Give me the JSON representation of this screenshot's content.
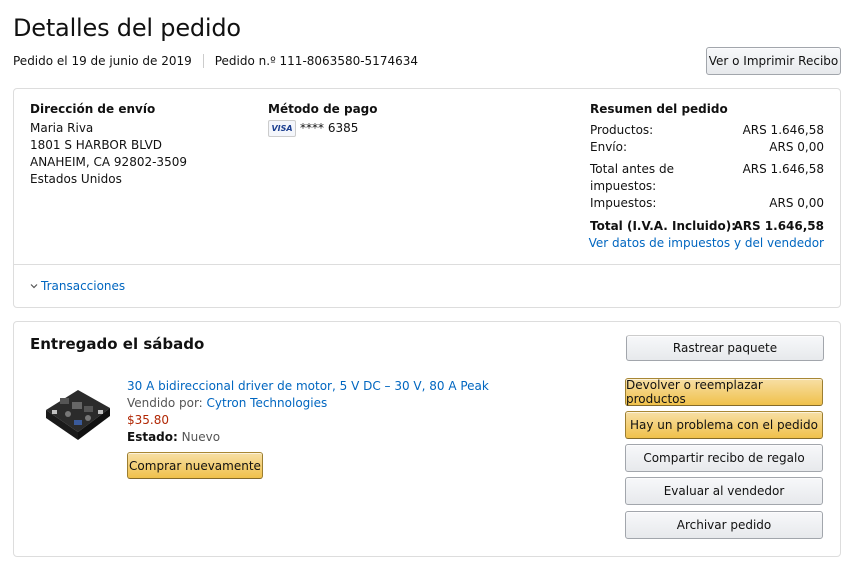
{
  "page": {
    "title": "Detalles del pedido",
    "order_date": "Pedido el 19 de junio de 2019",
    "order_number": "Pedido n.º 111-8063580-5174634",
    "receipt_button": "Ver o Imprimir Recibo"
  },
  "shipping": {
    "heading": "Dirección de envío",
    "name": "Maria Riva",
    "line1": "1801 S HARBOR BLVD",
    "line2": "ANAHEIM, CA 92802-3509",
    "country": "Estados Unidos"
  },
  "payment": {
    "heading": "Método de pago",
    "card_brand": "VISA",
    "card_last4": "**** 6385"
  },
  "summary": {
    "heading": "Resumen del pedido",
    "products_label": "Productos:",
    "products_value": "ARS 1.646,58",
    "shipping_label": "Envío:",
    "shipping_value": "ARS 0,00",
    "pretax_label_1": "Total antes de",
    "pretax_label_2": "impuestos:",
    "pretax_value": "ARS 1.646,58",
    "tax_label": "Impuestos:",
    "tax_value": "ARS 0,00",
    "total_label": "Total (I.V.A. Incluido):",
    "total_value": "ARS 1.646,58",
    "tax_link": "Ver datos de impuestos y del vendedor"
  },
  "transactions": {
    "label": "Transacciones"
  },
  "shipment": {
    "status": "Entregado el sábado",
    "item": {
      "title": "30 A bidireccional driver de motor, 5 V DC – 30 V, 80 A Peak",
      "sold_by_label": "Vendido por:",
      "seller": "Cytron Technologies",
      "price": "$35.80",
      "condition_label": "Estado:",
      "condition": "Nuevo",
      "buy_again": "Comprar nuevamente"
    },
    "actions": {
      "track": "Rastrear paquete",
      "return": "Devolver o reemplazar productos",
      "problem": "Hay un problema con el pedido",
      "gift_receipt": "Compartir recibo de regalo",
      "rate_seller": "Evaluar al vendedor",
      "archive": "Archivar pedido"
    }
  },
  "colors": {
    "link": "#0066c0",
    "price": "#b12704",
    "yellow_button": "#f0c14b",
    "border": "#dddddd"
  }
}
